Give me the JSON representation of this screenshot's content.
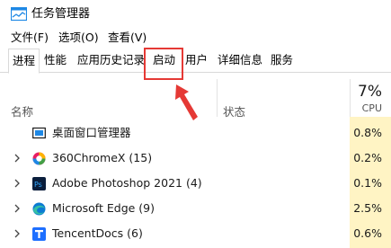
{
  "window": {
    "title": "任务管理器"
  },
  "menu": [
    "文件(F)",
    "选项(O)",
    "查看(V)"
  ],
  "tabs": [
    "进程",
    "性能",
    "应用历史记录",
    "启动",
    "用户",
    "详细信息",
    "服务"
  ],
  "active_tab": "进程",
  "highlighted_tab": "启动",
  "columns": {
    "name": "名称",
    "status": "状态",
    "cpu_percent": "7%",
    "cpu": "CPU"
  },
  "rows": [
    {
      "name": "桌面窗口管理器",
      "cpu": "0.8%",
      "icon": "window-manager-icon",
      "expandable": false
    },
    {
      "name": "360ChromeX (15)",
      "cpu": "0.2%",
      "icon": "360chrome-icon",
      "expandable": true
    },
    {
      "name": "Adobe Photoshop 2021 (4)",
      "cpu": "0.1%",
      "icon": "photoshop-icon",
      "expandable": true
    },
    {
      "name": "Microsoft Edge (9)",
      "cpu": "2.5%",
      "icon": "edge-icon",
      "expandable": true
    },
    {
      "name": "TencentDocs (6)",
      "cpu": "0.6%",
      "icon": "tencentdocs-icon",
      "expandable": true
    }
  ],
  "colors": {
    "cpu_column": "#fff4c4",
    "highlight": "#e53935",
    "app_icon": "#1e88e5"
  }
}
